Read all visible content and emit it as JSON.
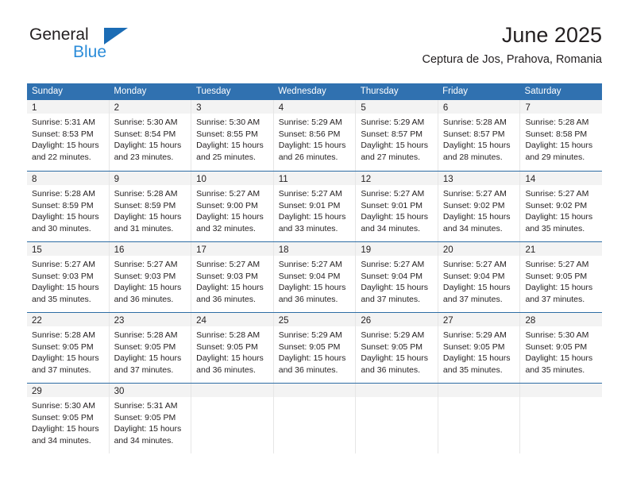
{
  "brand": {
    "name_top": "General",
    "name_bottom": "Blue"
  },
  "header": {
    "title": "June 2025",
    "subtitle": "Ceptura de Jos, Prahova, Romania"
  },
  "colors": {
    "header_blue": "#3071b0",
    "row_divider_blue": "#2e6da4",
    "daynum_band": "#f3f3f3",
    "brand_blue": "#2b8cd9",
    "text": "#231f20"
  },
  "weekday_headers": [
    "Sunday",
    "Monday",
    "Tuesday",
    "Wednesday",
    "Thursday",
    "Friday",
    "Saturday"
  ],
  "weeks": [
    [
      {
        "day": "1",
        "lines": [
          "Sunrise: 5:31 AM",
          "Sunset: 8:53 PM",
          "Daylight: 15 hours",
          "and 22 minutes."
        ]
      },
      {
        "day": "2",
        "lines": [
          "Sunrise: 5:30 AM",
          "Sunset: 8:54 PM",
          "Daylight: 15 hours",
          "and 23 minutes."
        ]
      },
      {
        "day": "3",
        "lines": [
          "Sunrise: 5:30 AM",
          "Sunset: 8:55 PM",
          "Daylight: 15 hours",
          "and 25 minutes."
        ]
      },
      {
        "day": "4",
        "lines": [
          "Sunrise: 5:29 AM",
          "Sunset: 8:56 PM",
          "Daylight: 15 hours",
          "and 26 minutes."
        ]
      },
      {
        "day": "5",
        "lines": [
          "Sunrise: 5:29 AM",
          "Sunset: 8:57 PM",
          "Daylight: 15 hours",
          "and 27 minutes."
        ]
      },
      {
        "day": "6",
        "lines": [
          "Sunrise: 5:28 AM",
          "Sunset: 8:57 PM",
          "Daylight: 15 hours",
          "and 28 minutes."
        ]
      },
      {
        "day": "7",
        "lines": [
          "Sunrise: 5:28 AM",
          "Sunset: 8:58 PM",
          "Daylight: 15 hours",
          "and 29 minutes."
        ]
      }
    ],
    [
      {
        "day": "8",
        "lines": [
          "Sunrise: 5:28 AM",
          "Sunset: 8:59 PM",
          "Daylight: 15 hours",
          "and 30 minutes."
        ]
      },
      {
        "day": "9",
        "lines": [
          "Sunrise: 5:28 AM",
          "Sunset: 8:59 PM",
          "Daylight: 15 hours",
          "and 31 minutes."
        ]
      },
      {
        "day": "10",
        "lines": [
          "Sunrise: 5:27 AM",
          "Sunset: 9:00 PM",
          "Daylight: 15 hours",
          "and 32 minutes."
        ]
      },
      {
        "day": "11",
        "lines": [
          "Sunrise: 5:27 AM",
          "Sunset: 9:01 PM",
          "Daylight: 15 hours",
          "and 33 minutes."
        ]
      },
      {
        "day": "12",
        "lines": [
          "Sunrise: 5:27 AM",
          "Sunset: 9:01 PM",
          "Daylight: 15 hours",
          "and 34 minutes."
        ]
      },
      {
        "day": "13",
        "lines": [
          "Sunrise: 5:27 AM",
          "Sunset: 9:02 PM",
          "Daylight: 15 hours",
          "and 34 minutes."
        ]
      },
      {
        "day": "14",
        "lines": [
          "Sunrise: 5:27 AM",
          "Sunset: 9:02 PM",
          "Daylight: 15 hours",
          "and 35 minutes."
        ]
      }
    ],
    [
      {
        "day": "15",
        "lines": [
          "Sunrise: 5:27 AM",
          "Sunset: 9:03 PM",
          "Daylight: 15 hours",
          "and 35 minutes."
        ]
      },
      {
        "day": "16",
        "lines": [
          "Sunrise: 5:27 AM",
          "Sunset: 9:03 PM",
          "Daylight: 15 hours",
          "and 36 minutes."
        ]
      },
      {
        "day": "17",
        "lines": [
          "Sunrise: 5:27 AM",
          "Sunset: 9:03 PM",
          "Daylight: 15 hours",
          "and 36 minutes."
        ]
      },
      {
        "day": "18",
        "lines": [
          "Sunrise: 5:27 AM",
          "Sunset: 9:04 PM",
          "Daylight: 15 hours",
          "and 36 minutes."
        ]
      },
      {
        "day": "19",
        "lines": [
          "Sunrise: 5:27 AM",
          "Sunset: 9:04 PM",
          "Daylight: 15 hours",
          "and 37 minutes."
        ]
      },
      {
        "day": "20",
        "lines": [
          "Sunrise: 5:27 AM",
          "Sunset: 9:04 PM",
          "Daylight: 15 hours",
          "and 37 minutes."
        ]
      },
      {
        "day": "21",
        "lines": [
          "Sunrise: 5:27 AM",
          "Sunset: 9:05 PM",
          "Daylight: 15 hours",
          "and 37 minutes."
        ]
      }
    ],
    [
      {
        "day": "22",
        "lines": [
          "Sunrise: 5:28 AM",
          "Sunset: 9:05 PM",
          "Daylight: 15 hours",
          "and 37 minutes."
        ]
      },
      {
        "day": "23",
        "lines": [
          "Sunrise: 5:28 AM",
          "Sunset: 9:05 PM",
          "Daylight: 15 hours",
          "and 37 minutes."
        ]
      },
      {
        "day": "24",
        "lines": [
          "Sunrise: 5:28 AM",
          "Sunset: 9:05 PM",
          "Daylight: 15 hours",
          "and 36 minutes."
        ]
      },
      {
        "day": "25",
        "lines": [
          "Sunrise: 5:29 AM",
          "Sunset: 9:05 PM",
          "Daylight: 15 hours",
          "and 36 minutes."
        ]
      },
      {
        "day": "26",
        "lines": [
          "Sunrise: 5:29 AM",
          "Sunset: 9:05 PM",
          "Daylight: 15 hours",
          "and 36 minutes."
        ]
      },
      {
        "day": "27",
        "lines": [
          "Sunrise: 5:29 AM",
          "Sunset: 9:05 PM",
          "Daylight: 15 hours",
          "and 35 minutes."
        ]
      },
      {
        "day": "28",
        "lines": [
          "Sunrise: 5:30 AM",
          "Sunset: 9:05 PM",
          "Daylight: 15 hours",
          "and 35 minutes."
        ]
      }
    ],
    [
      {
        "day": "29",
        "lines": [
          "Sunrise: 5:30 AM",
          "Sunset: 9:05 PM",
          "Daylight: 15 hours",
          "and 34 minutes."
        ]
      },
      {
        "day": "30",
        "lines": [
          "Sunrise: 5:31 AM",
          "Sunset: 9:05 PM",
          "Daylight: 15 hours",
          "and 34 minutes."
        ]
      },
      {
        "day": "",
        "lines": []
      },
      {
        "day": "",
        "lines": []
      },
      {
        "day": "",
        "lines": []
      },
      {
        "day": "",
        "lines": []
      },
      {
        "day": "",
        "lines": []
      }
    ]
  ]
}
